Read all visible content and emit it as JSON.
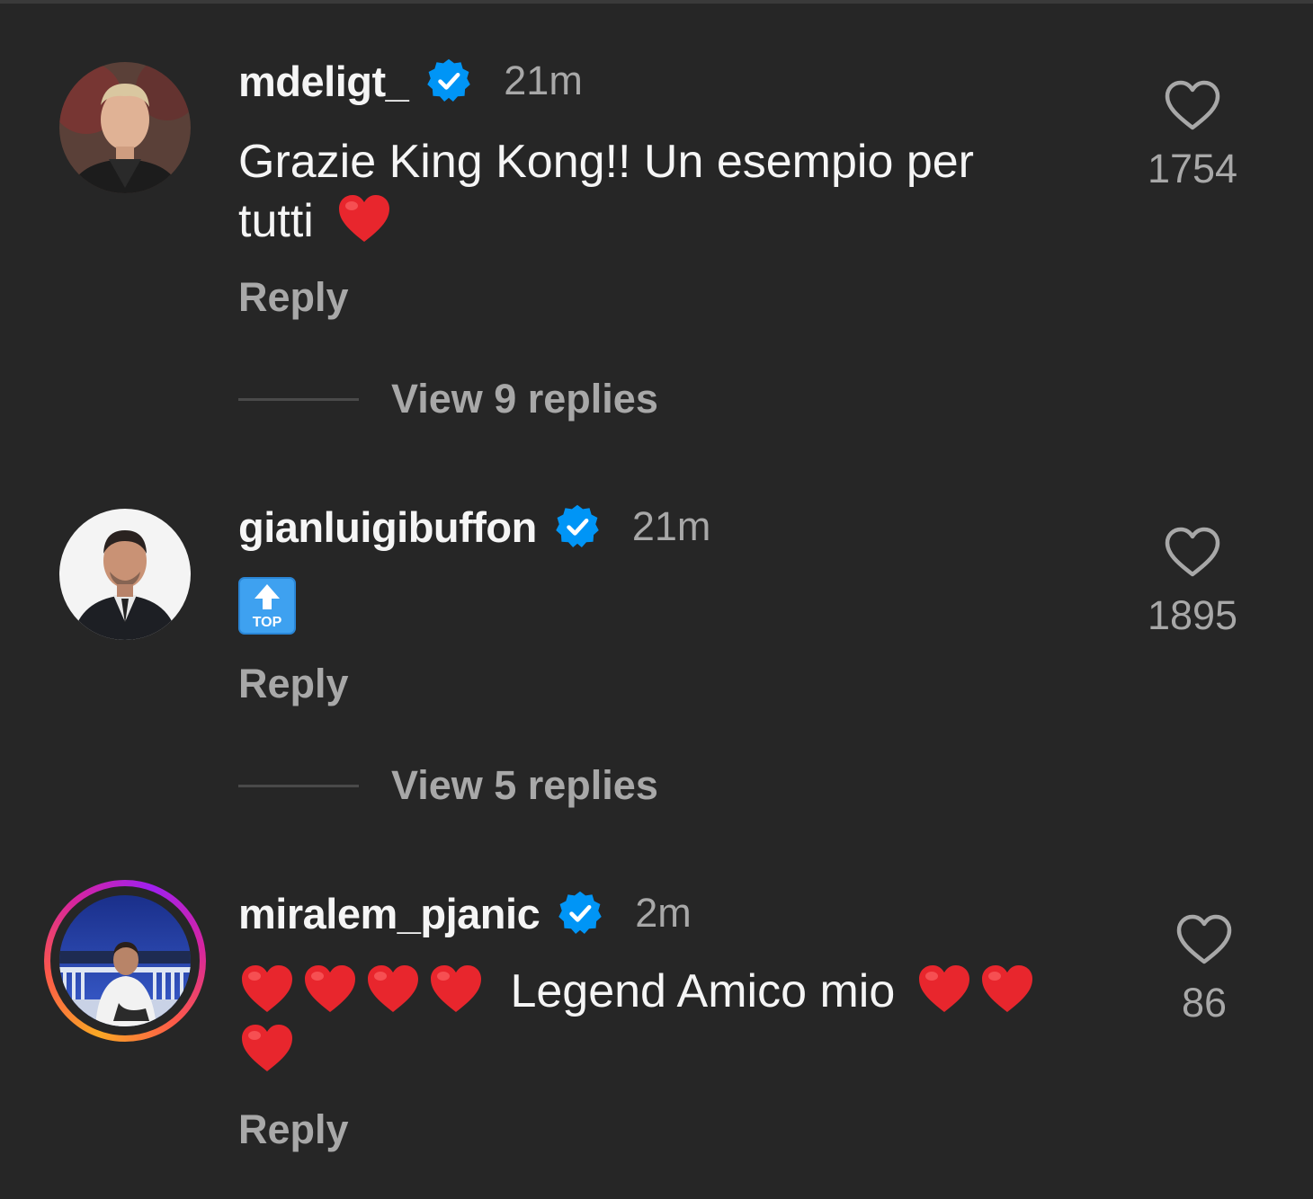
{
  "comments": [
    {
      "username": "mdeligt_",
      "time": "21m",
      "text": "Grazie King Kong!! Un esempio per tutti",
      "text_emoji": "red-heart",
      "reply_label": "Reply",
      "view_replies_label": "View 9 replies",
      "likes": "1754"
    },
    {
      "username": "gianluigibuffon",
      "time": "21m",
      "text_emoji": "top-arrow",
      "reply_label": "Reply",
      "view_replies_label": "View 5 replies",
      "likes": "1895"
    },
    {
      "username": "miralem_pjanic",
      "time": "2m",
      "text": "Legend Amico mio",
      "reply_label": "Reply",
      "likes": "86"
    }
  ],
  "emoji": {
    "top_label": "TOP"
  },
  "colors": {
    "background": "#262626",
    "primary_text": "#f5f5f5",
    "secondary_text": "#a8a8a8",
    "verified_blue": "#0095f6",
    "heart_red": "#e8262d"
  },
  "icons": [
    "verified-badge-icon",
    "heart-outline-icon",
    "red-heart-emoji",
    "top-arrow-emoji"
  ]
}
